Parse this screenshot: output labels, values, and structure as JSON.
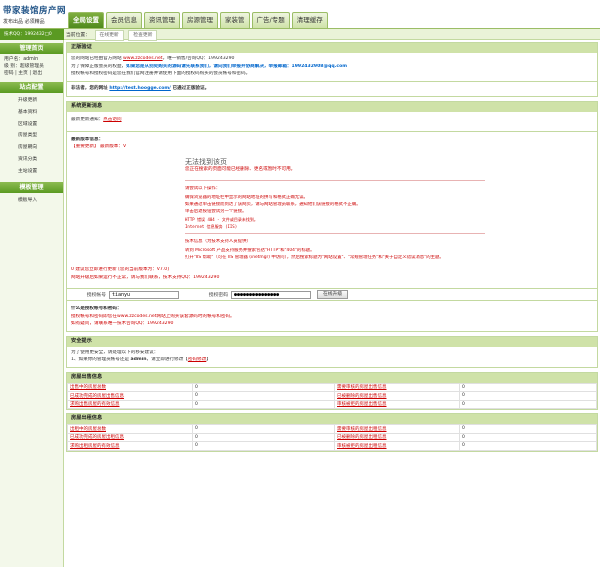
{
  "header": {
    "logo": "带家装馆房产网",
    "top_links": "发布出品 必须精品",
    "tabs": [
      "全局设置",
      "会员信息",
      "资讯管理",
      "房源管理",
      "家装管",
      "广告/专题",
      "清理缓存"
    ],
    "active_tab": 0
  },
  "subbar": {
    "userinfo": "技术QQ：1992432□0",
    "crumb_label": "当前位置：",
    "crumbs": [
      "在线更新",
      "检查更新"
    ]
  },
  "sidebar": {
    "head1": "管理首页",
    "user_lines": [
      "用户名：admin",
      "级 别：超级管理员",
      "密码 | 主页 | 退出"
    ],
    "head2": "站点配置",
    "items": [
      "升级更新",
      "基本资料",
      "区域设置",
      "房屋类型",
      "房屋朝向",
      "资讯分类",
      "主站设置"
    ],
    "head3": "模板管理",
    "items2": [
      "模板导入"
    ]
  },
  "auth": {
    "title": "正版验证",
    "line1a": "您的网站已经由官方网站 ",
    "line1_link": "www.zzcodes.net",
    "line1b": "，唯一销售/咨询QQ：199243290",
    "line2a": "为了保障正版会员的权益，",
    "line2_bold": "如果您是从别处购买的源码请先联系我们，请向我们举报并协商解决，举报邮箱：1992432908@qq.com",
    "line3": "授权帐号和授权密码是您在我们官网注册并请使用下面的授权码购买的会员帐号和密码。",
    "notice_a": "非法者，您的网址  ",
    "notice_link": "http://test.hoogge.com/",
    "notice_b": " 已通过正版验证。"
  },
  "update": {
    "title": "系统更新消息",
    "latest_label": "最新更新通知：",
    "latest_link": "点击访问",
    "new_info": "最新版本信息：",
    "version_line": "【重要更新】 最新版本：V"
  },
  "error": {
    "title": "无法找到该页",
    "subtitle": "您正在搜索的页面可能已经删除、更名或暂时不可用。",
    "try_head": "请尝试以下操作：",
    "tries": [
      "确保浏览器的地址栏中显示的网站地址的拼写和格式正确无误。",
      "如果通过单击链接而到达了该网页，请与网站管理员联系，通知他们该链接的格式不正确。",
      "单击后退按钮尝试另一个链接。"
    ],
    "codes": [
      "HTTP 错误 404 - 文件或目录未找到。",
      "Internet 信息服务 (IIS)"
    ],
    "tech_head": "技术信息（为技术支持人员提供）",
    "tech1": "转到 Microsoft 产品支持服务并搜索包括\"HTTP\"和\"404\"的标题。",
    "tech2": "打开\"IIS 帮助\"（可在 IIS 管理器 (inetmgr) 中访问），然后搜索标题为\"网站设置\"、\"常规管理任务\"和\"关于自定义错误消息\"的主题。"
  },
  "after_error": {
    "line1": "0 建议您立即进行更新 [您的当前版本为：V7.0]",
    "line2": "网站升级后如果运行不正常，请与我们联系，技术支持QQ：199243290"
  },
  "auth_form": {
    "account_label": "授权帐号",
    "account_value": "tianyu",
    "password_label": "授权密码",
    "password_value": "●●●●●●●●●●●●●●●",
    "button": "在线升级"
  },
  "whatis": {
    "title": "什么是授权帐号和密码：",
    "line1": "授权帐号和密码即您在www.zzcodes.net网站上购买该套源码时的帐号和密码。",
    "line2": "如有疑问，请联系唯一技术咨询QQ：199243290"
  },
  "security": {
    "title": "安全提示",
    "line1": "为了使用更安全，请处理以下的移安建议：",
    "line2a": "1、如果你的管理员帐号还是 ",
    "line2_bold": "admin",
    "line2b": "，请立即进行修改【",
    "line2_link": "密码修改",
    "line2c": "】"
  },
  "house_sell": {
    "title": "房屋出售信息",
    "rows": [
      [
        "出售中的房屋总数",
        "0",
        "需要审核的房屋出售信息",
        "0"
      ],
      [
        "已成功完成的房屋出售信息",
        "0",
        "已被删除的房屋出售信息",
        "0"
      ],
      [
        "求购出售房屋的有效信息",
        "0",
        "审核被拒的房屋出售信息",
        "0"
      ]
    ]
  },
  "house_rent": {
    "title": "房屋出租信息",
    "rows": [
      [
        "出租中的房屋总数",
        "0",
        "需要审核的房屋出租信息",
        "0"
      ],
      [
        "已成功完成的房屋出租信息",
        "0",
        "已被删除的房屋出租信息",
        "0"
      ],
      [
        "求购出租房屋的有效信息",
        "0",
        "审核被拒的房屋出租信息",
        "0"
      ]
    ]
  }
}
